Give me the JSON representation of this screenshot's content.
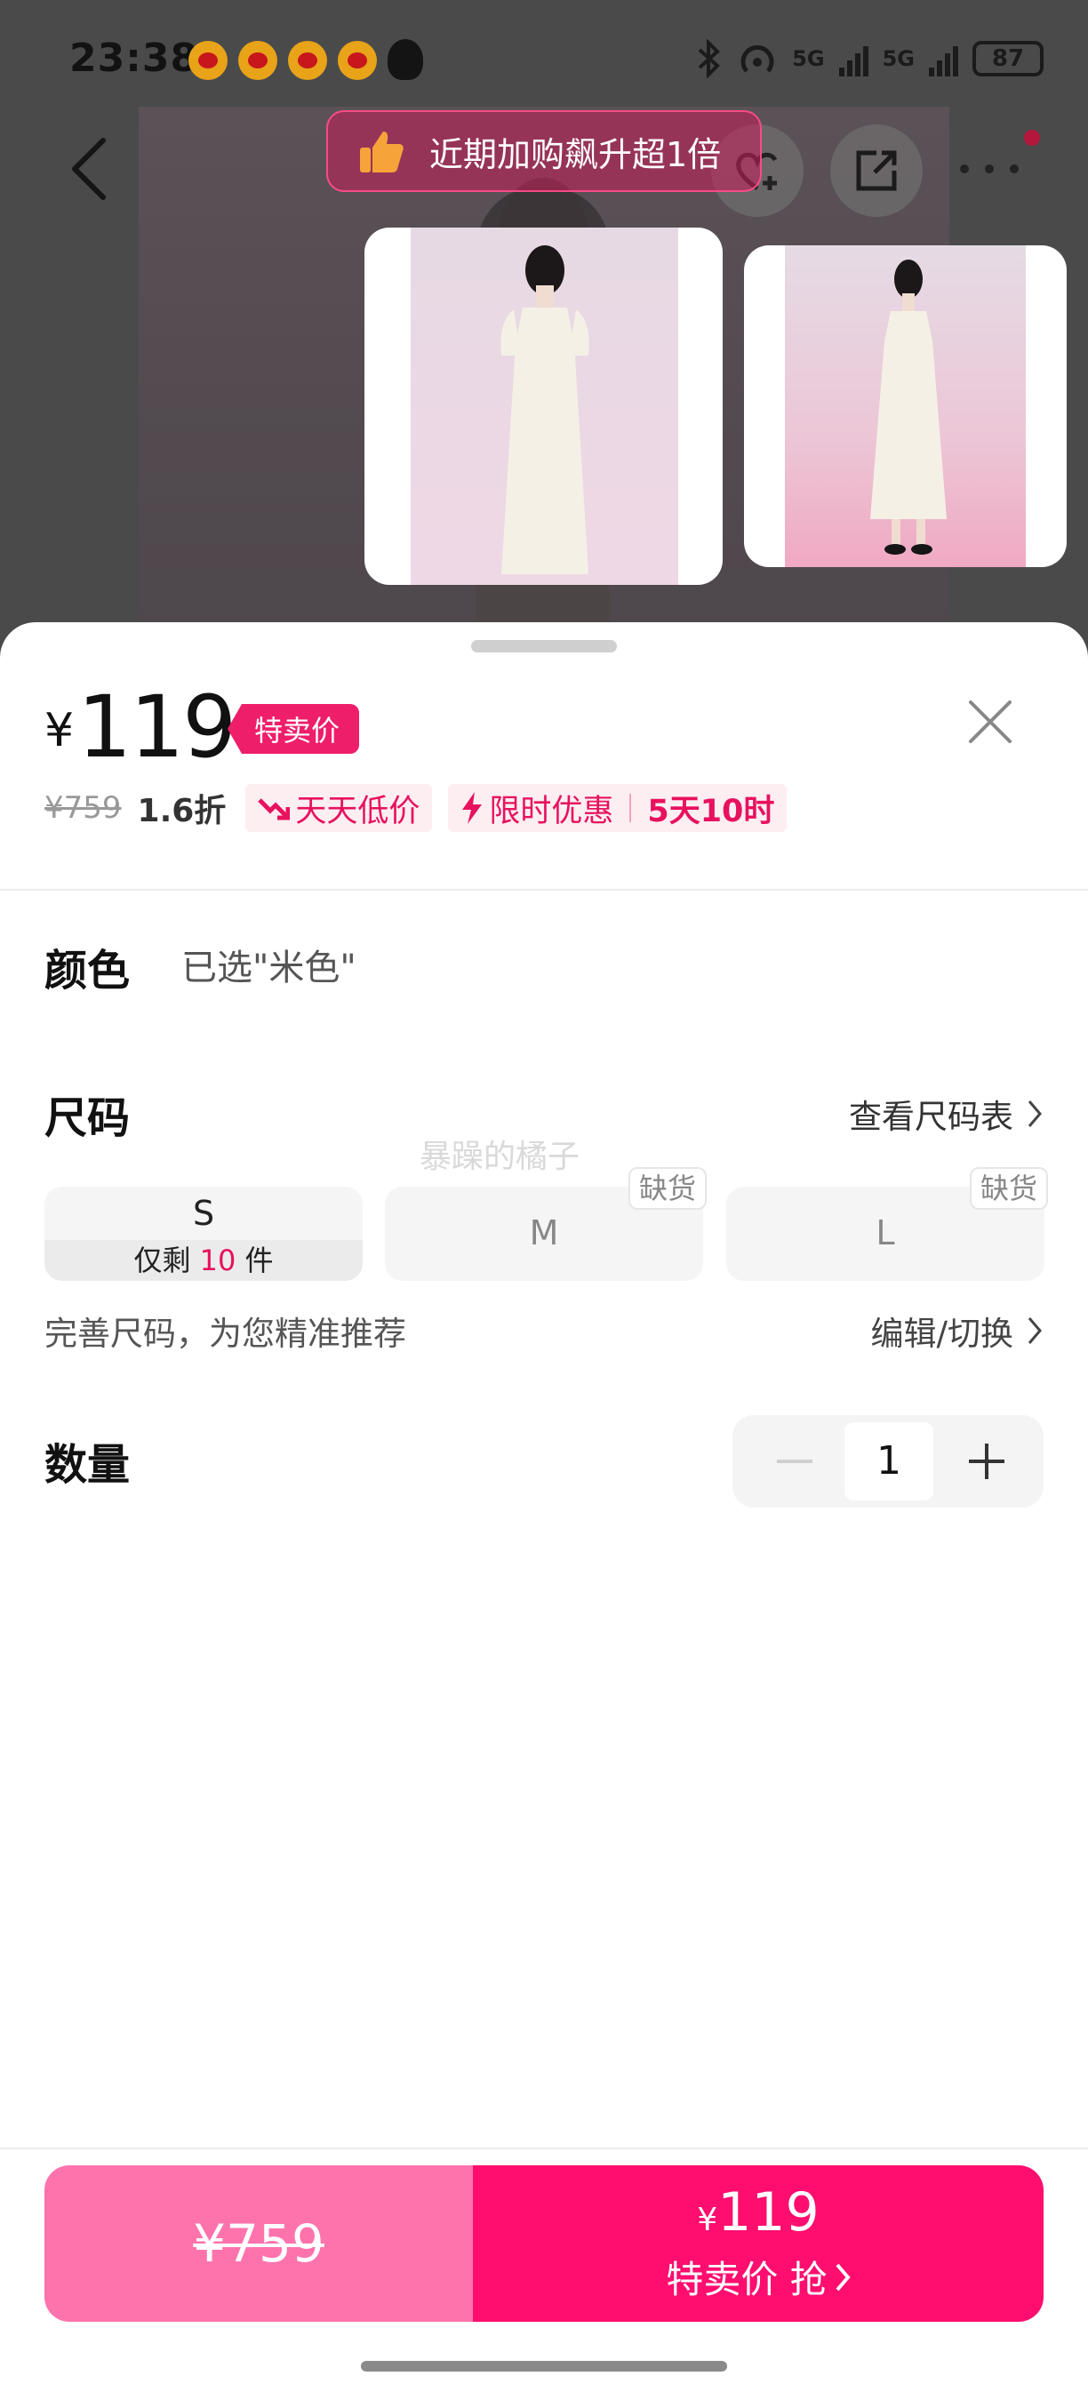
{
  "status_bar": {
    "time": "23:38",
    "battery": "87",
    "network_1": "5G",
    "network_2": "5G",
    "icons": [
      "weibo-icon",
      "weibo-icon",
      "weibo-icon",
      "weibo-icon",
      "qq-icon",
      "bluetooth-icon",
      "hotspot-icon",
      "signal-icon",
      "signal-icon",
      "battery-icon"
    ]
  },
  "toast": {
    "text": "近期加购飙升超1倍",
    "icon": "thumbs-up-icon"
  },
  "sheet": {
    "price": {
      "currency": "¥",
      "amount": "119",
      "tag": "特卖价",
      "original": "¥759",
      "discount": "1.6折",
      "chip_daily": "天天低价",
      "chip_limited": "限时优惠",
      "chip_countdown": "5天10时"
    },
    "color": {
      "label": "颜色",
      "selected": "已选\"米色\""
    },
    "size": {
      "label": "尺码",
      "chart_link": "查看尺码表",
      "watermark": "暴躁的橘子",
      "options": [
        {
          "label": "S",
          "stock_prefix": "仅剩",
          "stock_count": "10",
          "stock_suffix": "件",
          "out_of_stock": false
        },
        {
          "label": "M",
          "badge": "缺货",
          "out_of_stock": true
        },
        {
          "label": "L",
          "badge": "缺货",
          "out_of_stock": true
        }
      ],
      "perfect_text": "完善尺码，为您精准推荐",
      "edit_link": "编辑/切换"
    },
    "quantity": {
      "label": "数量",
      "value": "1"
    },
    "buy_bar": {
      "left_price": "¥759",
      "right_currency": "¥",
      "right_price": "119",
      "right_cta": "特卖价 抢"
    }
  },
  "colors": {
    "accent": "#ee1e6a",
    "accent_light": "#ff73ad",
    "cta": "#ff0d6f"
  }
}
